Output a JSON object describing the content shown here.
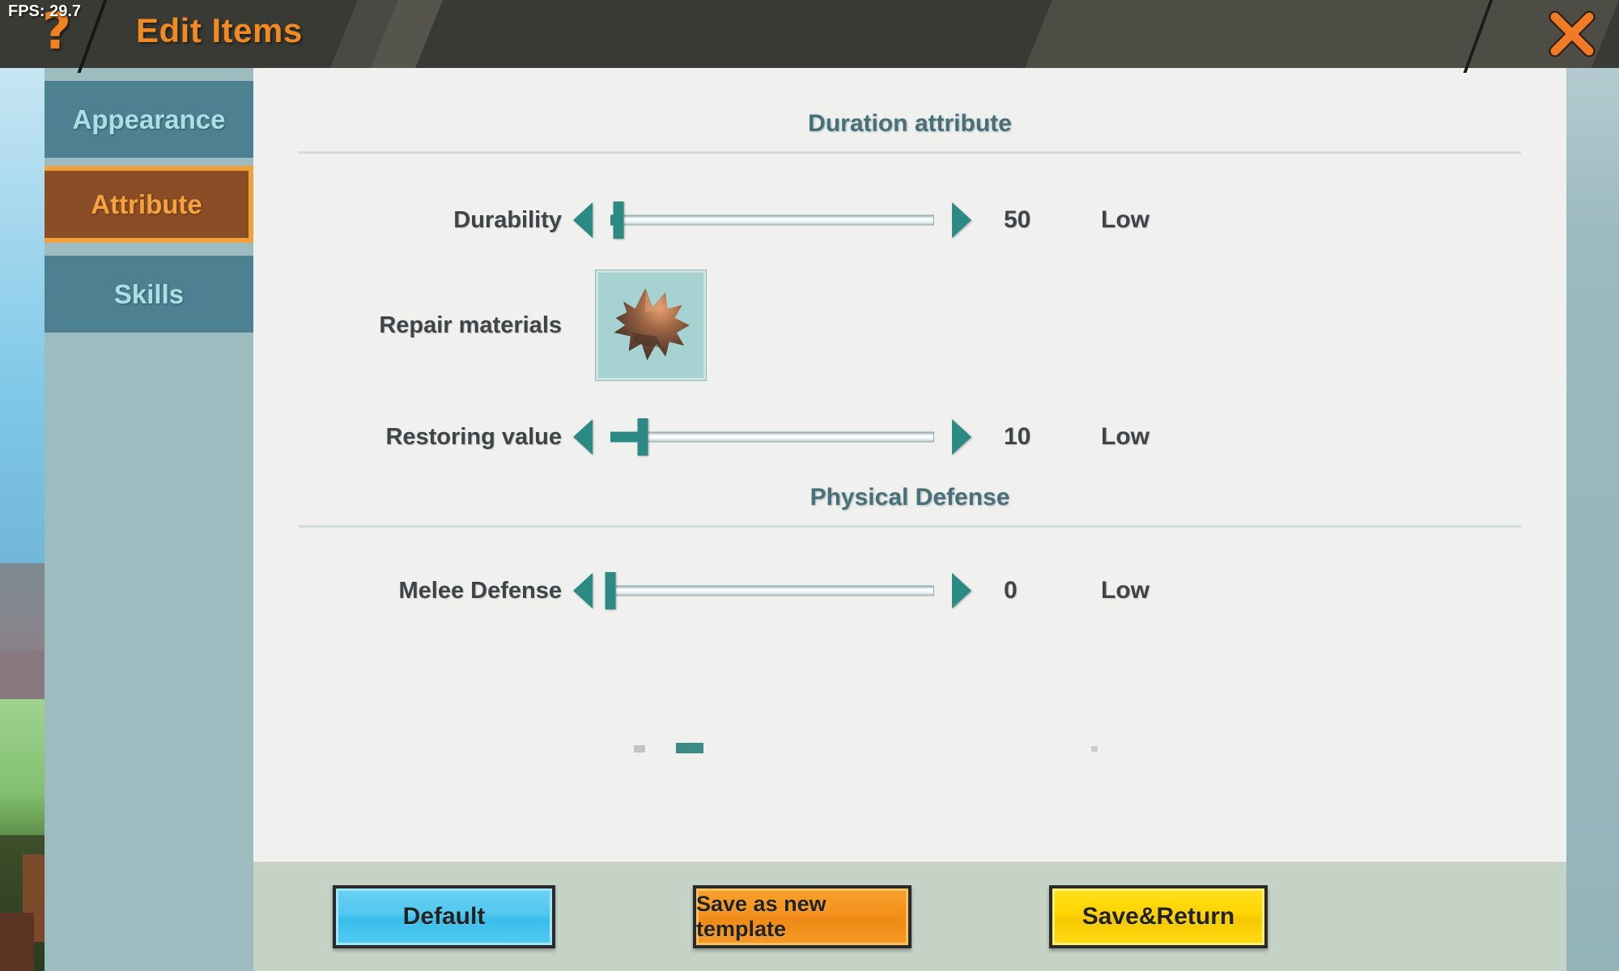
{
  "hud": {
    "fps_label": "FPS: 29.7",
    "help_icon_glyph": "?"
  },
  "titlebar": {
    "title": "Edit Items",
    "close_icon": "close-x-icon",
    "title_color": "#f08a22",
    "bar_color": "#3a3a35"
  },
  "sidebar": {
    "tabs": [
      {
        "label": "Appearance",
        "active": false
      },
      {
        "label": "Attribute",
        "active": true
      },
      {
        "label": "Skills",
        "active": false
      }
    ],
    "active_color": "#f6a33e",
    "inactive_color": "#a9e0e8"
  },
  "sections": [
    {
      "title": "Duration attribute",
      "rows": [
        {
          "type": "slider",
          "label": "Durability",
          "value": "50",
          "rating": "Low",
          "fill_percent": 0,
          "handle_percent": 2.5
        },
        {
          "type": "item-slot",
          "label": "Repair materials",
          "item_name": "animal-hide",
          "slot_bg": "#a6d2d2"
        },
        {
          "type": "slider",
          "label": "Restoring value",
          "value": "10",
          "rating": "Low",
          "fill_percent": 10,
          "handle_percent": 10
        }
      ]
    },
    {
      "title": "Physical Defense",
      "rows": [
        {
          "type": "slider",
          "label": "Melee Defense",
          "value": "0",
          "rating": "Low",
          "fill_percent": 0,
          "handle_percent": 0
        }
      ]
    }
  ],
  "footer": {
    "buttons": [
      {
        "label": "Default",
        "color": "#52c8f0"
      },
      {
        "label": "Save as new template",
        "color": "#f5921d"
      },
      {
        "label": "Save&Return",
        "color": "#ffd400"
      }
    ]
  },
  "theme": {
    "accent_teal": "#2c8a85",
    "panel_bg": "#f0f0ef",
    "sidebar_bg": "#9cbcc0",
    "footer_bg": "#c5d2c6",
    "section_header_color": "#46707a"
  }
}
